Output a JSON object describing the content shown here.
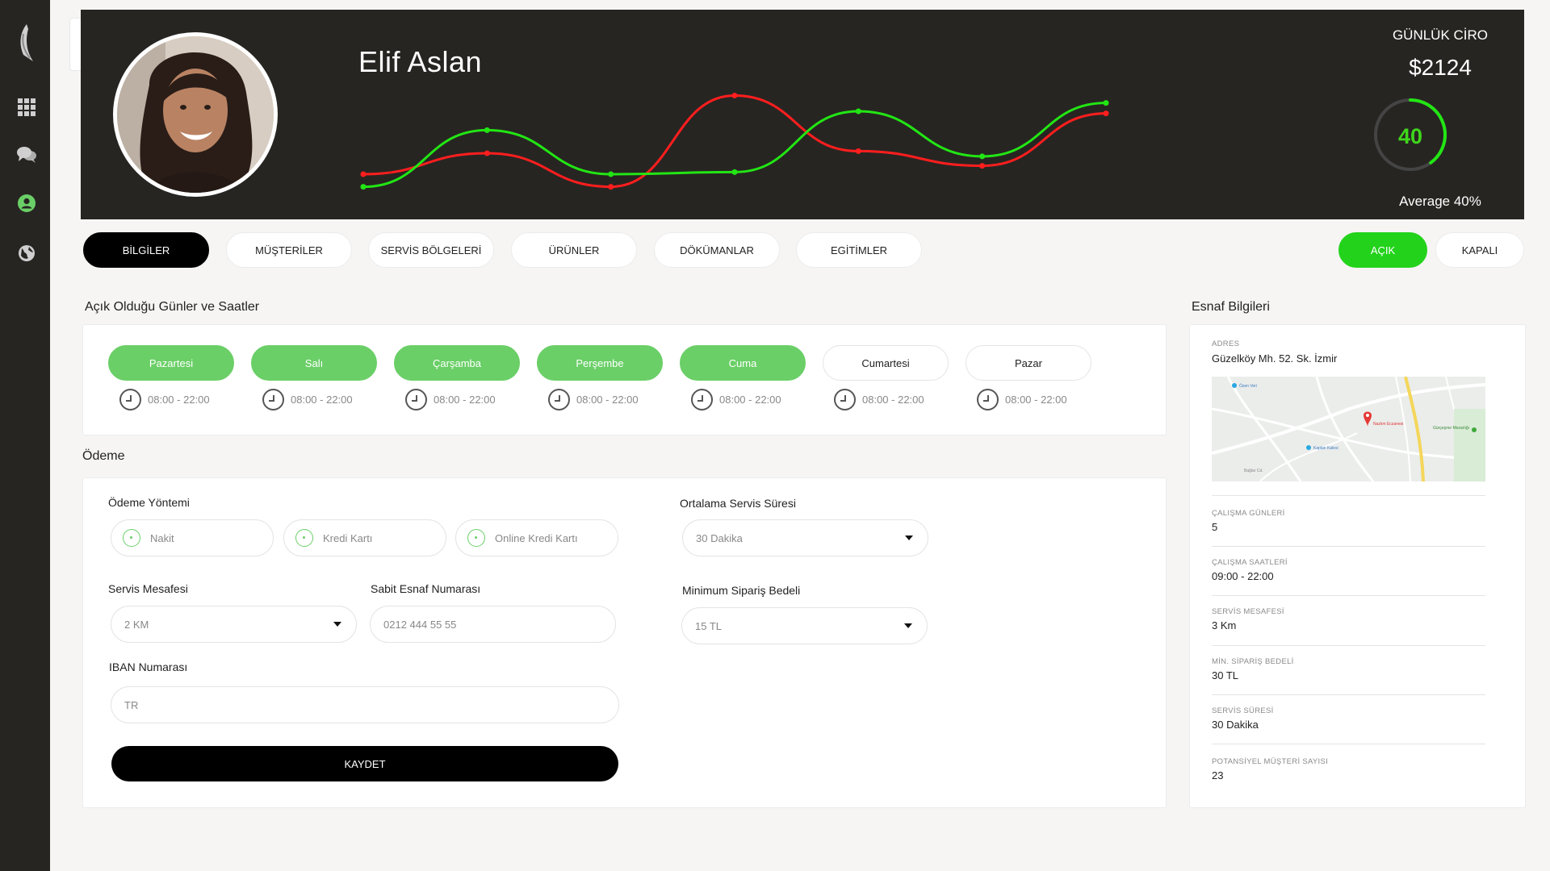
{
  "sidebar": {
    "items": [
      {
        "icon": "apps-grid-icon"
      },
      {
        "icon": "chat-bubbles-icon"
      },
      {
        "icon": "user-circle-icon",
        "active": true
      },
      {
        "icon": "globe-icon"
      }
    ]
  },
  "profile": {
    "name": "Elif Aslan"
  },
  "trend_chart": {
    "type": "line",
    "series": [
      {
        "color": "#ff1e1e",
        "values": [
          20,
          40,
          8,
          95,
          42,
          28,
          78
        ]
      },
      {
        "color": "#22e614",
        "values": [
          8,
          62,
          20,
          22,
          80,
          37,
          88
        ]
      }
    ]
  },
  "revenue": {
    "title": "GÜNLÜK CİRO",
    "value": "$2124",
    "gauge_value": "40",
    "gauge_fraction": 0.4,
    "average": "Average 40%"
  },
  "tabs": [
    "BİLGİLER",
    "MÜŞTERİLER",
    "SERVİS BÖLGELERİ",
    "ÜRÜNLER",
    "DÖKÜMANLAR",
    "EGİTİMLER"
  ],
  "status": {
    "open": "AÇIK",
    "closed": "KAPALI"
  },
  "hours": {
    "title": "Açık Olduğu Günler ve Saatler",
    "days": [
      {
        "label": "Pazartesi",
        "time": "08:00 - 22:00",
        "open": true
      },
      {
        "label": "Salı",
        "time": "08:00 - 22:00",
        "open": true
      },
      {
        "label": "Çarşamba",
        "time": "08:00 - 22:00",
        "open": true
      },
      {
        "label": "Perşembe",
        "time": "08:00 - 22:00",
        "open": true
      },
      {
        "label": "Cuma",
        "time": "08:00 - 22:00",
        "open": true
      },
      {
        "label": "Cumartesi",
        "time": "08:00 - 22:00",
        "open": false
      },
      {
        "label": "Pazar",
        "time": "08:00 - 22:00",
        "open": false
      }
    ]
  },
  "payment": {
    "title": "Ödeme",
    "method_label": "Ödeme Yöntemi",
    "methods": [
      "Nakit",
      "Kredi Kartı",
      "Online Kredi Kartı"
    ],
    "distance_label": "Servis Mesafesi",
    "distance_value": "2 KM",
    "phone_label": "Sabit Esnaf Numarası",
    "phone_placeholder": "0212 444 55 55",
    "iban_label": "IBAN Numarası",
    "iban_placeholder": "TR",
    "service_time_label": "Ortalama Servis Süresi",
    "service_time_value": "30 Dakika",
    "min_order_label": "Minimum Sipariş Bedeli",
    "min_order_value": "15 TL",
    "save": "KAYDET"
  },
  "merchant": {
    "title": "Esnaf Bilgileri",
    "address_label": "ADRES",
    "address": "Güzelköy Mh. 52. Sk. İzmir",
    "map_labels": [
      "Özen Veri",
      "Nazlım Eczanesi",
      "Gürçeşme Mezarlığı",
      "Kaplan Kalesi",
      "Bağlar Cd."
    ],
    "rows": [
      {
        "label": "ÇALIŞMA GÜNLERİ",
        "value": "5"
      },
      {
        "label": "ÇALIŞMA SAATLERİ",
        "value": "09:00 - 22:00"
      },
      {
        "label": "SERVİS MESAFESİ",
        "value": "3 Km"
      },
      {
        "label": "MİN. SİPARİŞ BEDELİ",
        "value": "30 TL"
      },
      {
        "label": "SERVİS SÜRESİ",
        "value": "30 Dakika"
      },
      {
        "label": "POTANSİYEL MÜŞTERİ SAYISI",
        "value": "23"
      }
    ]
  }
}
